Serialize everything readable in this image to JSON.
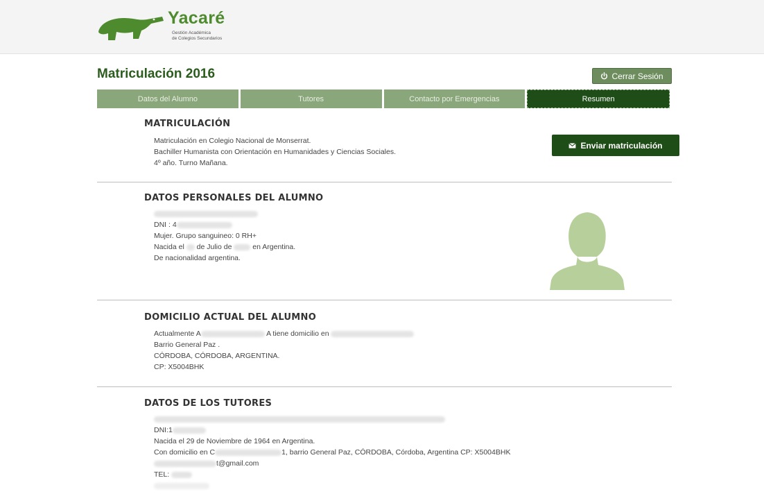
{
  "app": {
    "title": "Yacaré",
    "subtitle_line1": "Gestión Académica",
    "subtitle_line2": "de Colegios Secundarios"
  },
  "page": {
    "title": "Matriculación 2016",
    "logout_label": "Cerrar Sesión"
  },
  "tabs": [
    {
      "label": "Datos del Alumno",
      "active": false
    },
    {
      "label": "Tutores",
      "active": false
    },
    {
      "label": "Contacto por Emergencias",
      "active": false
    },
    {
      "label": "Resumen",
      "active": true
    }
  ],
  "actions": {
    "send_label": "Enviar matriculación"
  },
  "matriculacion": {
    "heading": "MATRICULACIÓN",
    "line1": "Matriculación en Colegio Nacional de Monserrat.",
    "line2": "Bachiller Humanista con Orientación en Humanidades y Ciencias Sociales.",
    "line3": "4º año. Turno Mañana."
  },
  "alumno": {
    "heading": "DATOS PERSONALES DEL ALUMNO",
    "dni_prefix": "DNI : 4",
    "line_sex": "Mujer. Grupo sanguineo: 0 RH+",
    "birth_prefix": "Nacida el ",
    "birth_mid": " de Julio de ",
    "birth_suffix": " en Argentina.",
    "nationality": "De nacionalidad argentina."
  },
  "domicilio": {
    "heading": "DOMICILIO ACTUAL DEL ALUMNO",
    "line1_prefix": "Actualmente A",
    "line1_mid": "A tiene domicilio en",
    "barrio": "Barrio General Paz .",
    "city": "CÓRDOBA, CÓRDOBA, ARGENTINA.",
    "cp": "CP: X5004BHK"
  },
  "tutores": {
    "heading": "DATOS DE LOS TUTORES",
    "dni_prefix": "DNI:1",
    "birth": "Nacida el 29 de Noviembre de 1964 en Argentina.",
    "address_prefix": "Con domicilio en C",
    "address_suffix": "1, barrio General Paz, CÓRDOBA, Córdoba, Argentina CP: X5004BHK",
    "email_suffix": "t@gmail.com",
    "tel_prefix": "TEL: "
  },
  "colors": {
    "brand": "#4e8a2e",
    "dark_green": "#1f4d17",
    "tab_green": "#8aa67b",
    "avatar": "#b7cf9a"
  },
  "icons": {
    "logo": "caiman-logo-icon",
    "logout": "power-icon",
    "send": "envelope-icon",
    "avatar": "female-avatar-icon"
  }
}
